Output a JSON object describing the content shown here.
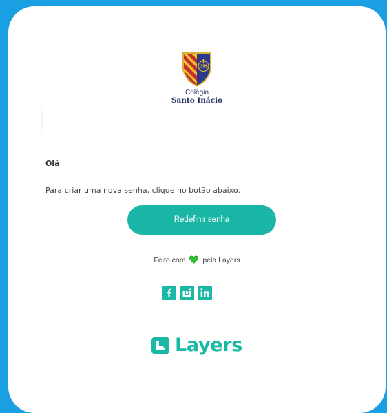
{
  "email": {
    "school_logo": {
      "line1": "Colégio",
      "line2": "Santo Inácio",
      "monogram": "IHS"
    },
    "greeting": "Olá",
    "message": "Para criar uma nova senha, clique no botão abaixo.",
    "reset_button_label": "Redefinir senha",
    "footer": {
      "made_with_prefix": "Feito com",
      "made_with_suffix": "pela Layers",
      "heart_icon": "heart-icon",
      "socials": [
        {
          "name": "facebook",
          "icon": "facebook-icon",
          "glyph": "f"
        },
        {
          "name": "instagram",
          "icon": "instagram-icon"
        },
        {
          "name": "linkedin",
          "icon": "linkedin-icon",
          "glyph": "in"
        }
      ],
      "brand_name": "Layers"
    }
  },
  "colors": {
    "background": "#1a9fe3",
    "accent": "#19b6a6",
    "heart": "#2fc12f",
    "school_blue": "#24326a"
  }
}
